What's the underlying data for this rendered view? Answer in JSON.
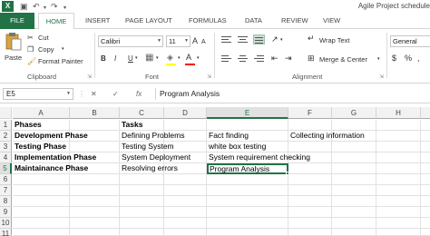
{
  "window": {
    "title": "Agile Project schedule",
    "app_icon": "X"
  },
  "tabs": [
    "FILE",
    "HOME",
    "INSERT",
    "PAGE LAYOUT",
    "FORMULAS",
    "DATA",
    "REVIEW",
    "VIEW"
  ],
  "active_tab": "HOME",
  "ribbon": {
    "clipboard": {
      "paste_label": "Paste",
      "cut_label": "Cut",
      "copy_label": "Copy",
      "format_painter_label": "Format Painter",
      "group_label": "Clipboard"
    },
    "font": {
      "font_name": "Calibri",
      "font_size": "11",
      "group_label": "Font",
      "bold": "B",
      "italic": "I",
      "underline": "U",
      "grow": "A",
      "shrink": "A",
      "font_color_glyph": "A",
      "highlight_color": "#ffff00",
      "font_color": "#ff0000"
    },
    "alignment": {
      "wrap_text_label": "Wrap Text",
      "merge_center_label": "Merge & Center",
      "group_label": "Alignment"
    },
    "number": {
      "format": "General"
    }
  },
  "formula_bar": {
    "name_box": "E5",
    "cancel": "✕",
    "enter": "✓",
    "fx": "fx",
    "content": "Program Analysis"
  },
  "sheet": {
    "columns": [
      "A",
      "B",
      "C",
      "D",
      "E",
      "F",
      "G",
      "H"
    ],
    "rows": [
      "1",
      "2",
      "3",
      "4",
      "5",
      "6",
      "7",
      "8",
      "9",
      "10",
      "11"
    ],
    "selected_cell": "E5",
    "cells": {
      "A1": "Phases",
      "C1": "Tasks",
      "A2": "Development Phase",
      "C2": "Defining Problems",
      "E2": "Fact finding",
      "F2": "Collecting information",
      "A3": "Testing Phase",
      "C3": "Testing  System",
      "E3": "white box testing",
      "A4": "Implementation Phase",
      "C4": "System Deployment",
      "E4": "System requirement checking",
      "A5": "Maintainance Phase",
      "C5": "Resolving errors",
      "E5": "Program Analysis"
    }
  }
}
